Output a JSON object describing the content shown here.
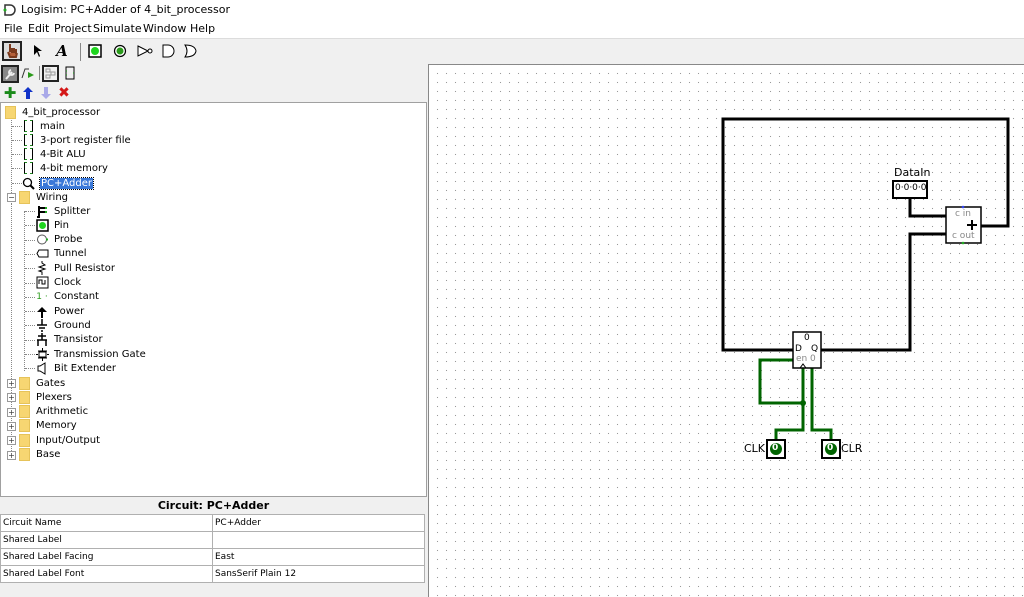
{
  "window": {
    "title": "Logisim: PC+Adder of 4_bit_processor"
  },
  "menu": [
    "File",
    "Edit",
    "Project",
    "Simulate",
    "Window",
    "Help"
  ],
  "toolbar": {
    "tools": [
      "poke-tool",
      "select-tool",
      "text-tool",
      "input-pin",
      "output-pin",
      "not-gate",
      "and-gate",
      "or-gate"
    ],
    "row2": [
      "edit-layout",
      "edit-appearance",
      "view-toolbox",
      "view-simulation"
    ],
    "row3": [
      "add-circuit",
      "move-up",
      "move-down",
      "remove-circuit"
    ]
  },
  "explorer": {
    "project": "4_bit_processor",
    "circuits": [
      {
        "label": "main",
        "selected": false
      },
      {
        "label": "3-port register file",
        "selected": false
      },
      {
        "label": "4-Bit ALU",
        "selected": false
      },
      {
        "label": "4-bit memory",
        "selected": false
      },
      {
        "label": "PC+Adder",
        "selected": true
      }
    ],
    "wiring": {
      "label": "Wiring",
      "items": [
        "Splitter",
        "Pin",
        "Probe",
        "Tunnel",
        "Pull Resistor",
        "Clock",
        "Constant",
        "Power",
        "Ground",
        "Transistor",
        "Transmission Gate",
        "Bit Extender"
      ]
    },
    "libraries": [
      "Gates",
      "Plexers",
      "Arithmetic",
      "Memory",
      "Input/Output",
      "Base"
    ]
  },
  "attributes": {
    "header": "Circuit: PC+Adder",
    "rows": [
      {
        "name": "Circuit Name",
        "value": "PC+Adder"
      },
      {
        "name": "Shared Label",
        "value": ""
      },
      {
        "name": "Shared Label Facing",
        "value": "East"
      },
      {
        "name": "Shared Label Font",
        "value": "SansSerif Plain 12"
      }
    ]
  },
  "circuit": {
    "datain_label": "DataIn",
    "datain_value": "0·0·0·0",
    "adder_cin": "c in",
    "adder_cout": "c out",
    "adder_symbol": "+",
    "register_value": "0",
    "register_d": "D",
    "register_q": "Q",
    "register_en": "en",
    "register_clr": "0",
    "clk_label": "CLK",
    "clk_value": "0",
    "clr_label": "CLR",
    "clr_value": "0",
    "wire_color_on": "#006400",
    "wire_color_bus": "#000000"
  }
}
